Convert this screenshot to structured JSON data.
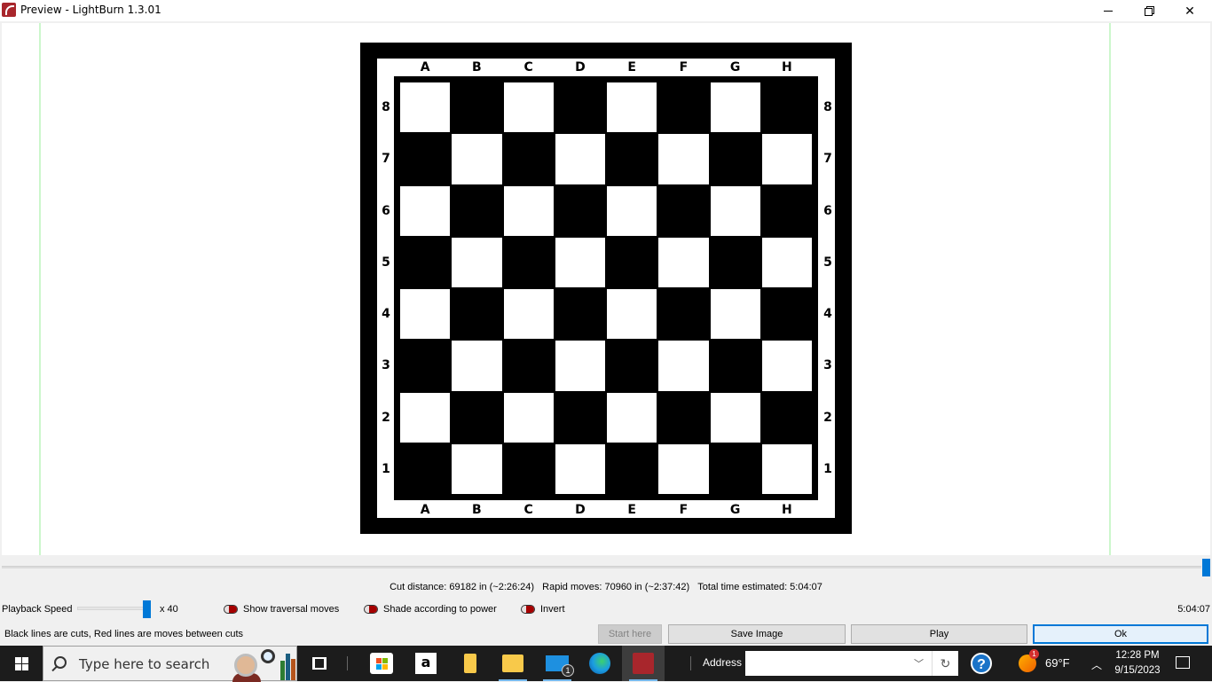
{
  "window": {
    "title": "Preview - LightBurn 1.3.01",
    "controls": {
      "minimize": "minimize",
      "maximize": "restore",
      "close": "close"
    }
  },
  "board": {
    "files": [
      "A",
      "B",
      "C",
      "D",
      "E",
      "F",
      "G",
      "H"
    ],
    "ranks": [
      "8",
      "7",
      "6",
      "5",
      "4",
      "3",
      "2",
      "1"
    ],
    "colors": {
      "dark": "#000000",
      "light": "#ffffff"
    }
  },
  "playback": {
    "position_fraction": 1.0
  },
  "stats": {
    "cut_distance": "Cut distance: 69182 in (~2:26:24)",
    "rapid_moves": "Rapid moves: 70960 in (~2:37:42)",
    "total_time": "Total time estimated: 5:04:07"
  },
  "controls": {
    "playback_speed_label": "Playback Speed",
    "playback_speed_value": "x 40",
    "playback_speed_fraction": 0.92,
    "toggles": [
      {
        "label": "Show traversal moves",
        "checked": false
      },
      {
        "label": "Shade according to power",
        "checked": false
      },
      {
        "label": "Invert",
        "checked": false
      }
    ],
    "elapsed_time": "5:04:07",
    "hint": "Black lines are cuts, Red lines are moves between cuts"
  },
  "buttons": {
    "start_here": "Start here",
    "save_image": "Save Image",
    "play": "Play",
    "ok": "Ok"
  },
  "taskbar": {
    "search_placeholder": "Type here to search",
    "apps": [
      "task-view",
      "microsoft-store",
      "amazon",
      "onedrive-folder",
      "file-explorer",
      "mail",
      "edge",
      "lightburn"
    ],
    "mail_badge": "1",
    "amazon_glyph": "a",
    "address_label": "Address",
    "address_value": "",
    "weather_badge": "1",
    "temperature": "69°F",
    "time": "12:28 PM",
    "date": "9/15/2023",
    "help_glyph": "?"
  },
  "accent_colors": {
    "primary": "#0078d7",
    "toggle_red": "#a50000",
    "guide_green": "#ccf7cc",
    "lightburn_red": "#a8262c"
  }
}
